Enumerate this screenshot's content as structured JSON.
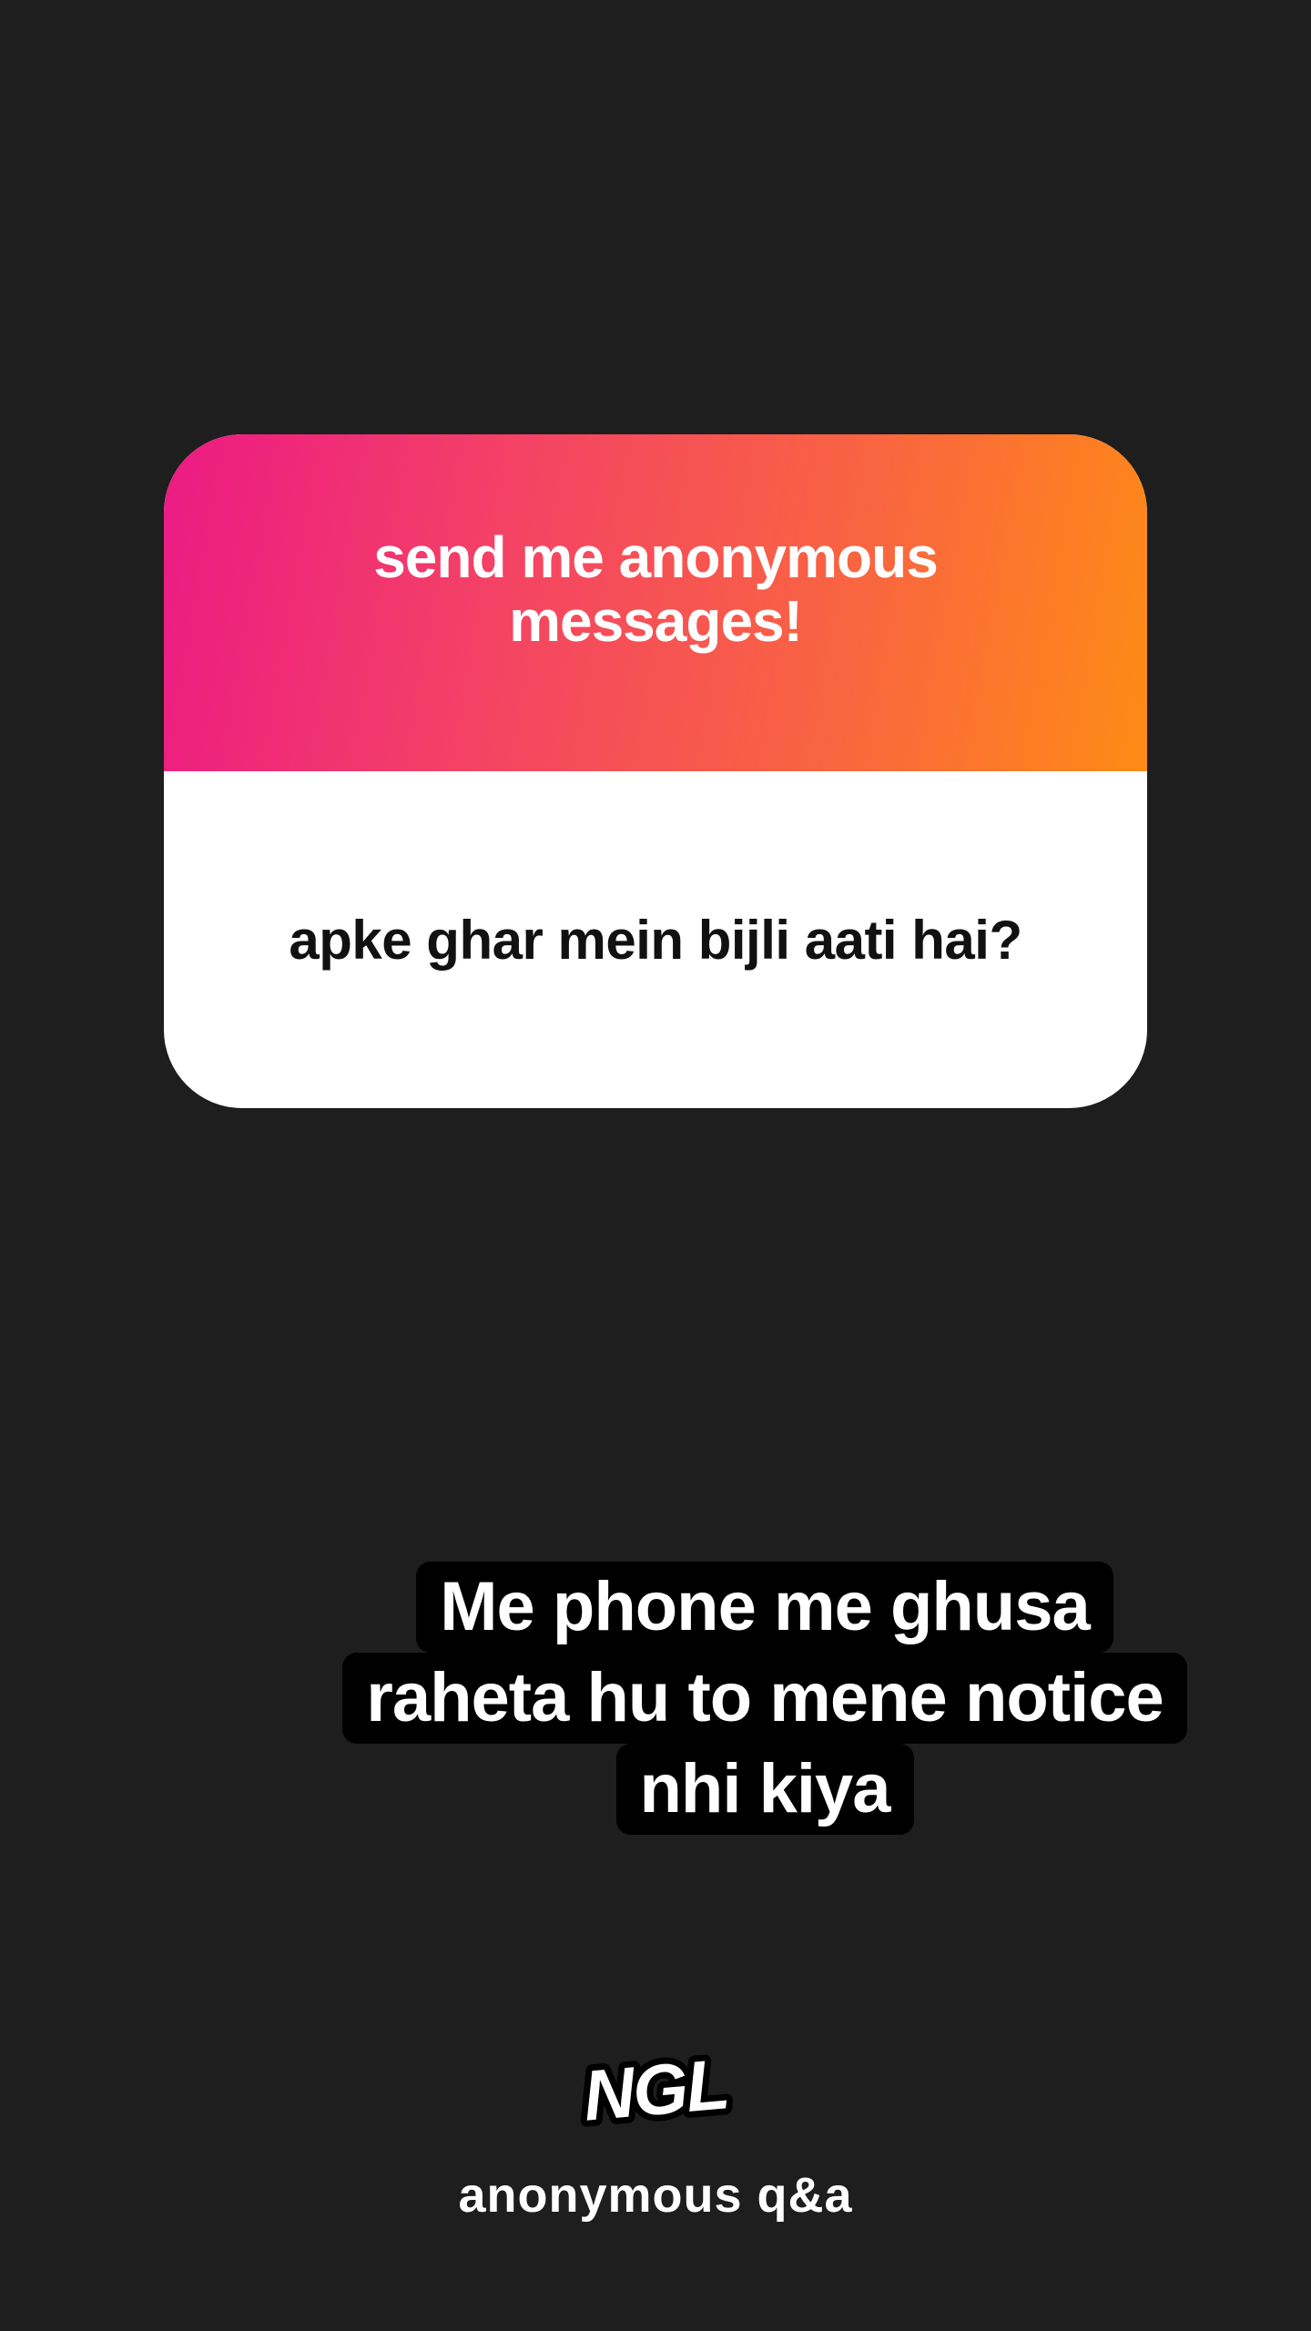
{
  "card": {
    "title": "send me anonymous messages!",
    "question": "apke ghar mein bijli aati hai?"
  },
  "reply": {
    "lines": [
      "Me phone me ghusa",
      "raheta hu to mene notice",
      "nhi kiya"
    ]
  },
  "brand": {
    "logo_text": "NGL",
    "tagline": "anonymous q&a"
  },
  "colors": {
    "background": "#1e1e1e",
    "gradient_start": "#ec1a84",
    "gradient_end": "#ff8b15",
    "card_body": "#ffffff",
    "reply_highlight": "#000000"
  }
}
